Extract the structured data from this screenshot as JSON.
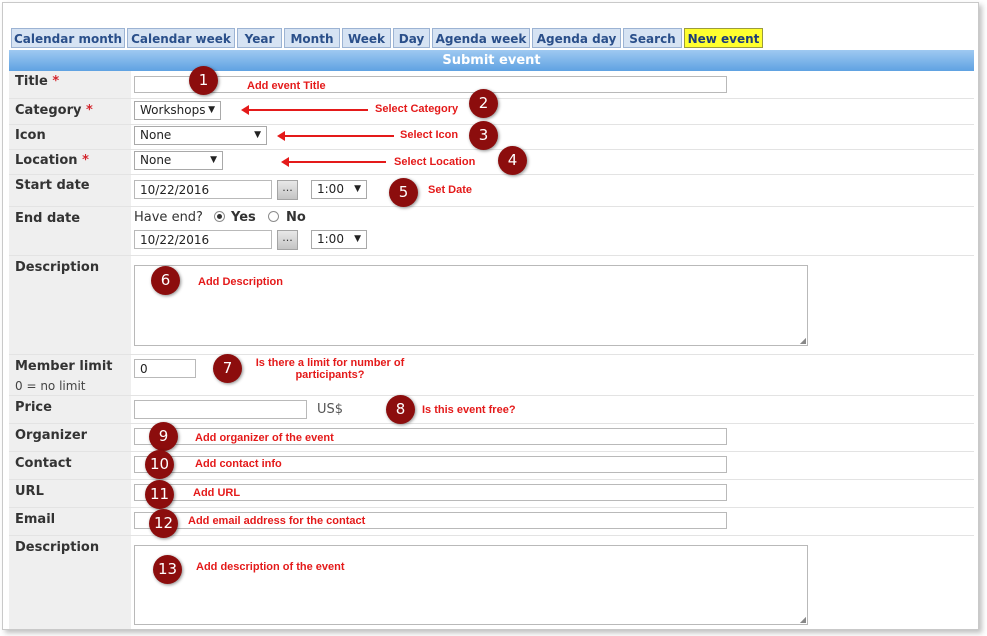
{
  "tabs": [
    {
      "label": "Calendar month"
    },
    {
      "label": "Calendar week"
    },
    {
      "label": "Year"
    },
    {
      "label": "Month"
    },
    {
      "label": "Week"
    },
    {
      "label": "Day"
    },
    {
      "label": "Agenda week"
    },
    {
      "label": "Agenda day"
    },
    {
      "label": "Search"
    },
    {
      "label": "New event",
      "active": true
    }
  ],
  "header": {
    "title": "Submit event"
  },
  "fields": {
    "title": {
      "label": "Title",
      "required": "*",
      "value": ""
    },
    "category": {
      "label": "Category",
      "required": "*",
      "value": "Workshops"
    },
    "icon": {
      "label": "Icon",
      "value": "None"
    },
    "location": {
      "label": "Location",
      "required": "*",
      "value": "None"
    },
    "start_date": {
      "label": "Start date",
      "date": "10/22/2016",
      "picker": "...",
      "time": "1:00"
    },
    "end_date": {
      "label": "End date",
      "have_end": "Have end?",
      "yes": "Yes",
      "no": "No",
      "date": "10/22/2016",
      "picker": "...",
      "time": "1:00"
    },
    "description": {
      "label": "Description",
      "value": ""
    },
    "member_limit": {
      "label": "Member limit",
      "hint": "0 = no limit",
      "value": "0"
    },
    "price": {
      "label": "Price",
      "value": "",
      "currency": "US$"
    },
    "organizer": {
      "label": "Organizer",
      "value": ""
    },
    "contact": {
      "label": "Contact",
      "value": ""
    },
    "url": {
      "label": "URL",
      "value": ""
    },
    "email": {
      "label": "Email",
      "value": ""
    },
    "description2": {
      "label": "Description",
      "value": ""
    }
  },
  "annotations": [
    {
      "number": "1",
      "text": "Add event Title"
    },
    {
      "number": "2",
      "text": "Select Category"
    },
    {
      "number": "3",
      "text": "Select Icon"
    },
    {
      "number": "4",
      "text": "Select Location"
    },
    {
      "number": "5",
      "text": "Set Date"
    },
    {
      "number": "6",
      "text": "Add Description"
    },
    {
      "number": "7",
      "text_line1": "Is there a limit for number of",
      "text_line2": "participants?"
    },
    {
      "number": "8",
      "text": "Is this event free?"
    },
    {
      "number": "9",
      "text": "Add organizer of the event"
    },
    {
      "number": "10",
      "text": "Add contact info"
    },
    {
      "number": "11",
      "text": "Add URL"
    },
    {
      "number": "12",
      "text": "Add email address for the contact"
    },
    {
      "number": "13",
      "text": "Add description of the event"
    }
  ],
  "colors": {
    "header": "#5fa2e2",
    "active_tab": "#ffff2e",
    "badge": "#8c0d0d",
    "annotation": "#e41a1a"
  }
}
